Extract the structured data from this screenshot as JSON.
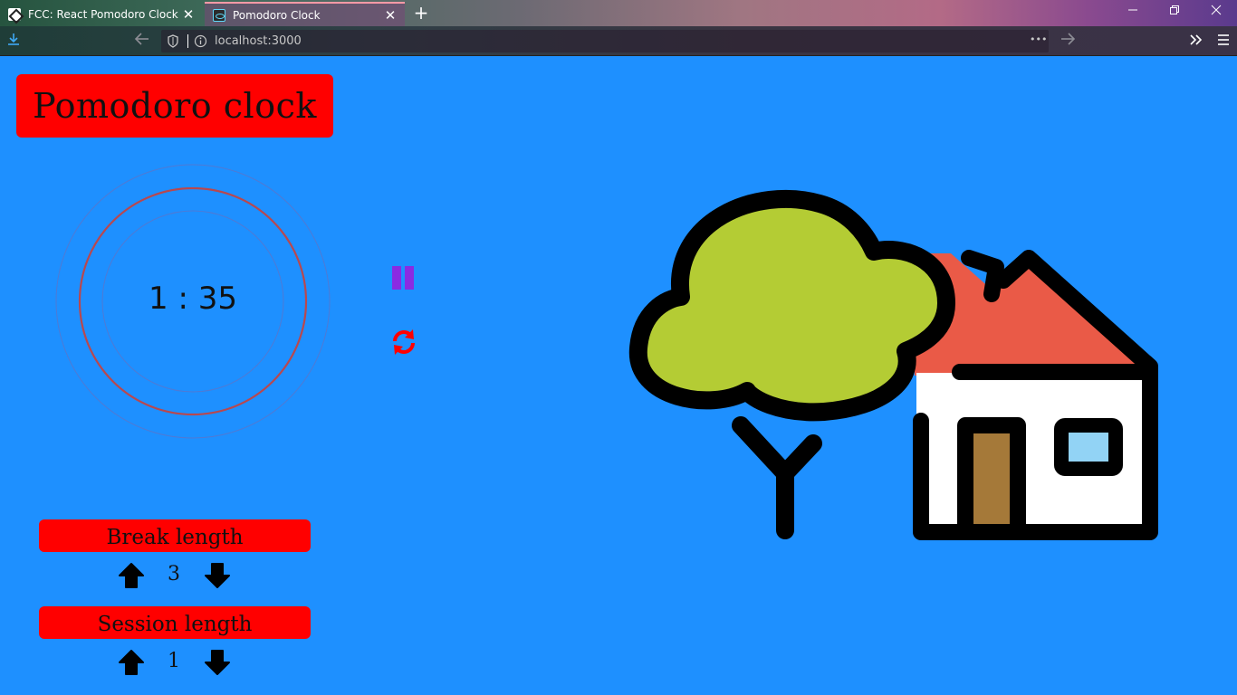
{
  "browser": {
    "tabs": [
      {
        "title": "FCC: React Pomodoro Clock",
        "active": false
      },
      {
        "title": "Pomodoro Clock",
        "active": true
      }
    ],
    "url": "localhost:3000",
    "close_glyph": "✕",
    "new_tab_glyph": "+",
    "url_more_glyph": "•••"
  },
  "app": {
    "title": "Pomodoro clock",
    "timer": {
      "display": "1 : 35"
    },
    "controls": {
      "pause_icon": "pause-icon",
      "reset_icon": "refresh-icon",
      "pause_color": "#8a2be2",
      "reset_color": "#ff0000"
    },
    "break": {
      "label": "Break length",
      "value": "3"
    },
    "session": {
      "label": "Session length",
      "value": "1"
    }
  },
  "colors": {
    "background": "#1e90ff",
    "label_bg": "#ff0000",
    "tree_leaves": "#b4cc34",
    "roof": "#ea5a47",
    "door": "#a57939",
    "window": "#92d3f5",
    "wall": "#ffffff",
    "ring": "#b8484f"
  }
}
